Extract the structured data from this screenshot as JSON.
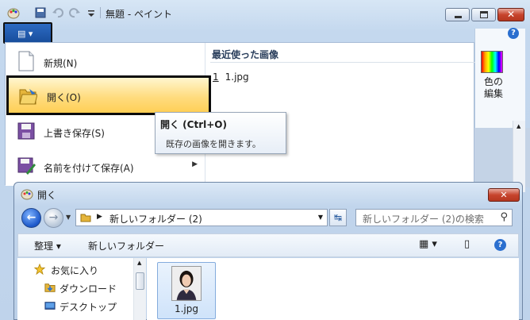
{
  "app": {
    "title": "無題 - ペイント",
    "color_edit_label": "色の\n編集",
    "help_glyph": "?"
  },
  "file_menu": {
    "button_glyph": "▤ ▾",
    "items": [
      {
        "label": "新規(N)",
        "has_arrow": false
      },
      {
        "label": "開く(O)",
        "has_arrow": false,
        "active": true
      },
      {
        "label": "上書き保存(S)",
        "has_arrow": false
      },
      {
        "label": "名前を付けて保存(A)",
        "has_arrow": true
      }
    ],
    "recent_title": "最近使った画像",
    "recent_items": [
      {
        "num": "1",
        "name": "1.jpg"
      }
    ]
  },
  "tooltip": {
    "title": "開く (Ctrl+O)",
    "body": "既存の画像を開きます。"
  },
  "open_dialog": {
    "title": "開く",
    "close_glyph": "✕",
    "address_path": "新しいフォルダー (2)",
    "search_placeholder": "新しいフォルダー (2)の検索",
    "toolbar": {
      "organize": "整理 ▾",
      "new_folder": "新しいフォルダー"
    },
    "nav_items": [
      {
        "label": "お気に入り",
        "icon": "star-icon"
      },
      {
        "label": "ダウンロード",
        "icon": "download-folder-icon"
      },
      {
        "label": "デスクトップ",
        "icon": "desktop-icon"
      }
    ],
    "files": [
      {
        "name": "1.jpg",
        "icon": "photo-thumbnail"
      }
    ]
  },
  "colors": {
    "active_item_gradient": "#ffd76a",
    "close_red": "#c7442d",
    "accent_blue": "#1b57c9"
  }
}
